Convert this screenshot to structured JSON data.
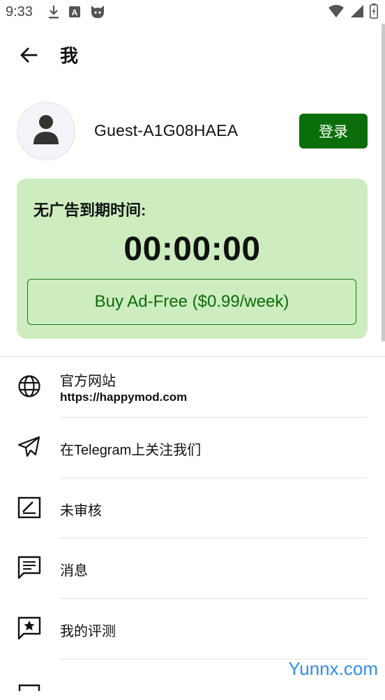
{
  "status_bar": {
    "time": "9:33"
  },
  "app_bar": {
    "title": "我"
  },
  "profile": {
    "guest_name": "Guest-A1G08HAEA",
    "login_label": "登录"
  },
  "ad_free": {
    "label": "无广告到期时间:",
    "timer": "00:00:00",
    "buy_label": "Buy Ad-Free ($0.99/week)"
  },
  "menu": {
    "items": [
      {
        "icon": "globe-icon",
        "label": "官方网站",
        "sub": "https://happymod.com"
      },
      {
        "icon": "telegram-icon",
        "label": "在Telegram上关注我们"
      },
      {
        "icon": "review-pending-icon",
        "label": "未审核"
      },
      {
        "icon": "message-icon",
        "label": "消息"
      },
      {
        "icon": "star-review-icon",
        "label": "我的评测"
      }
    ]
  },
  "watermark": "Yunnx.com",
  "colors": {
    "accent": "#0a6e0a",
    "card_bg": "#cdecbf"
  }
}
